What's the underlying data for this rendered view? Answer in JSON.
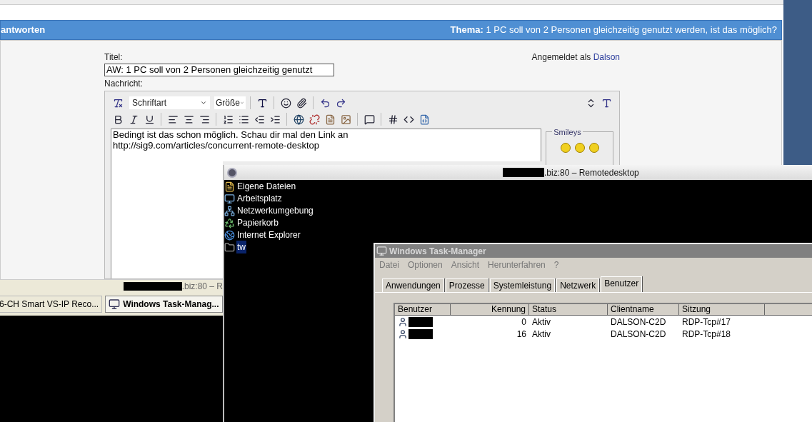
{
  "forum": {
    "header_left": "antworten",
    "topic_label": "Thema:",
    "topic": "1 PC soll von 2 Personen gleichzeitig genutzt werden, ist das möglich?",
    "title_label": "Titel:",
    "title_value": "AW: 1 PC soll von 2 Personen gleichzeitig genutzt",
    "logged_in_label": "Angemeldet als",
    "user": "Dalson",
    "message_label": "Nachricht:",
    "font_select": "Schriftart",
    "size_select": "Größe",
    "message_lines": [
      "Bedingt ist das schon möglich. Schau dir mal den Link an",
      "http://sig9.com/articles/concurrent-remote-desktop"
    ],
    "smileys_legend": "Smileys"
  },
  "browser_status": ".biz:80 – R",
  "taskbar": [
    {
      "label": "6-CH Smart VS-IP Reco...",
      "selected": false
    },
    {
      "label": "Windows Task-Manag...",
      "selected": true
    }
  ],
  "remote_desktop": {
    "title": ".biz:80 – Remotedesktop",
    "icons": [
      {
        "label": "Eigene Dateien",
        "kind": "documents",
        "selected": false
      },
      {
        "label": "Arbeitsplatz",
        "kind": "computer",
        "selected": false
      },
      {
        "label": "Netzwerkumgebung",
        "kind": "network",
        "selected": false
      },
      {
        "label": "Papierkorb",
        "kind": "recycle",
        "selected": false
      },
      {
        "label": "Internet Explorer",
        "kind": "browser",
        "selected": false
      },
      {
        "label": "tw",
        "kind": "folder",
        "selected": true
      }
    ]
  },
  "task_manager": {
    "title": "Windows Task-Manager",
    "menu": [
      "Datei",
      "Optionen",
      "Ansicht",
      "Herunterfahren",
      "?"
    ],
    "tabs": [
      {
        "label": "Anwendungen",
        "selected": false
      },
      {
        "label": "Prozesse",
        "selected": false
      },
      {
        "label": "Systemleistung",
        "selected": false
      },
      {
        "label": "Netzwerk",
        "selected": false
      },
      {
        "label": "Benutzer",
        "selected": true
      }
    ],
    "columns": [
      "Benutzer",
      "Kennung",
      "Status",
      "Clientname",
      "Sitzung"
    ],
    "rows": [
      {
        "id": "0",
        "status": "Aktiv",
        "client": "DALSON-C2D",
        "session": "RDP-Tcp#17"
      },
      {
        "id": "16",
        "status": "Aktiv",
        "client": "DALSON-C2D",
        "session": "RDP-Tcp#18"
      }
    ]
  }
}
